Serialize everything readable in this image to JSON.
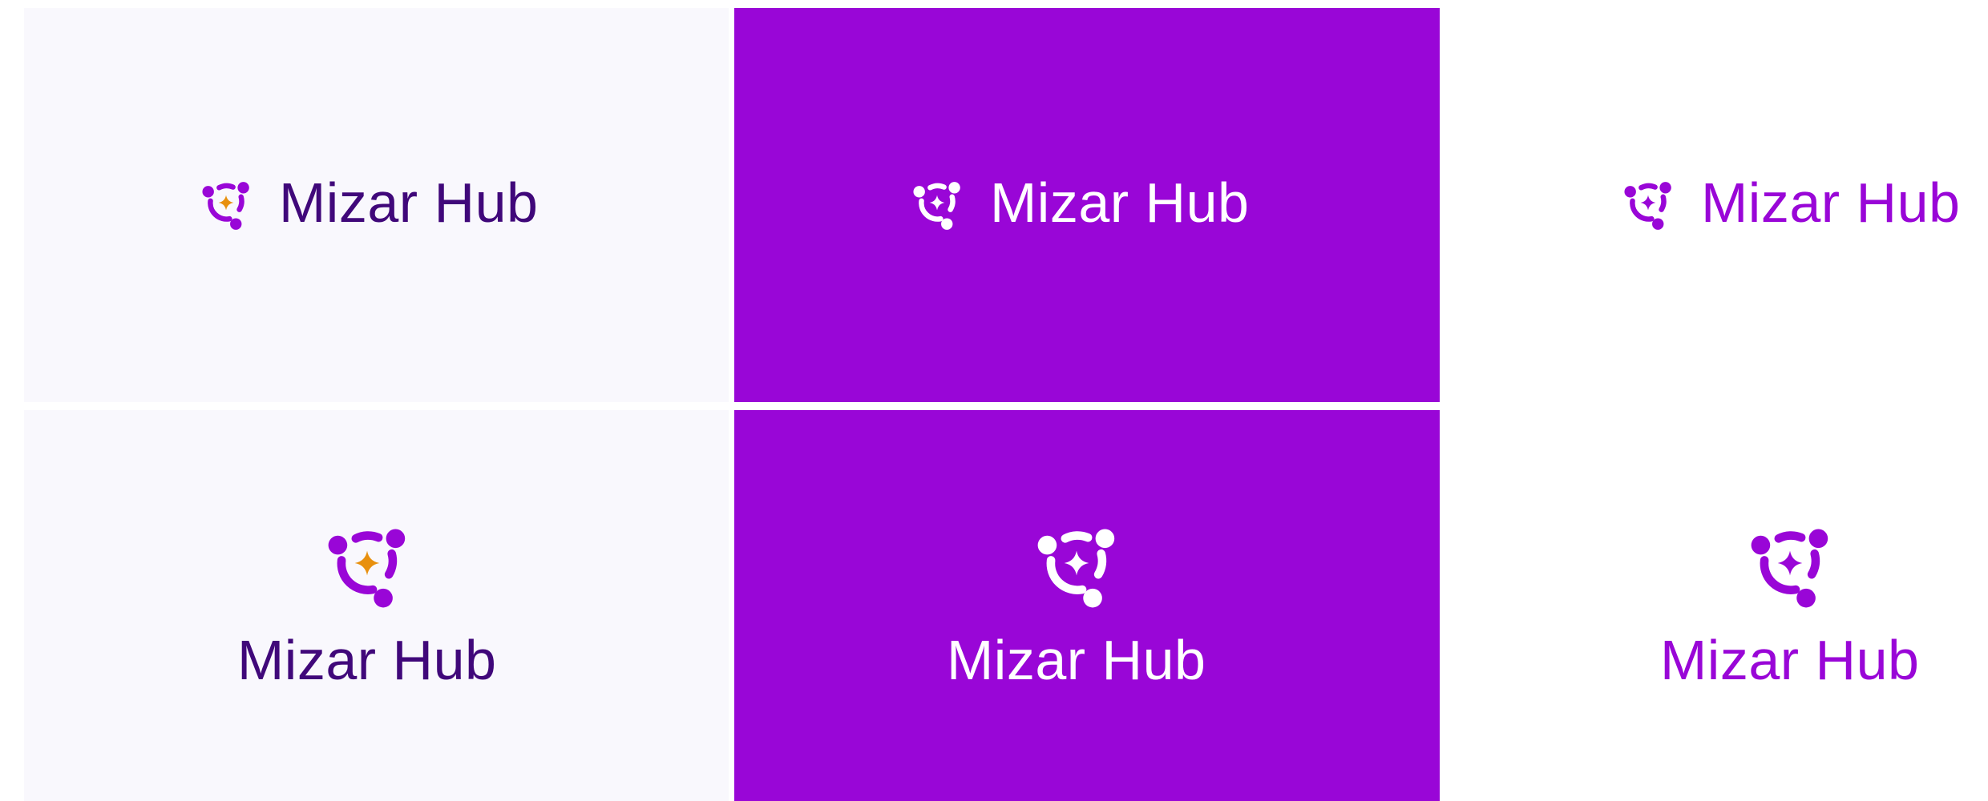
{
  "brand": {
    "name": "Mizar Hub"
  },
  "colors": {
    "purple": "#9906d7",
    "deep_purple": "#40087a",
    "star_orange": "#e8900e",
    "light_background": "#f9f8fd",
    "white": "#ffffff"
  },
  "variants": [
    {
      "layout": "horizontal",
      "background": "light",
      "mark": "purple-with-orange-star",
      "text": "Mizar Hub",
      "text_color": "#40087a"
    },
    {
      "layout": "horizontal",
      "background": "purple",
      "mark": "white",
      "text": "Mizar Hub",
      "text_color": "#ffffff"
    },
    {
      "layout": "horizontal",
      "background": "white",
      "mark": "purple",
      "text": "Mizar Hub",
      "text_color": "#9906d7"
    },
    {
      "layout": "stacked",
      "background": "light",
      "mark": "purple-with-orange-star",
      "text": "Mizar Hub",
      "text_color": "#40087a"
    },
    {
      "layout": "stacked",
      "background": "purple",
      "mark": "white",
      "text": "Mizar Hub",
      "text_color": "#ffffff"
    },
    {
      "layout": "stacked",
      "background": "white",
      "mark": "purple",
      "text": "Mizar Hub",
      "text_color": "#9906d7"
    }
  ]
}
